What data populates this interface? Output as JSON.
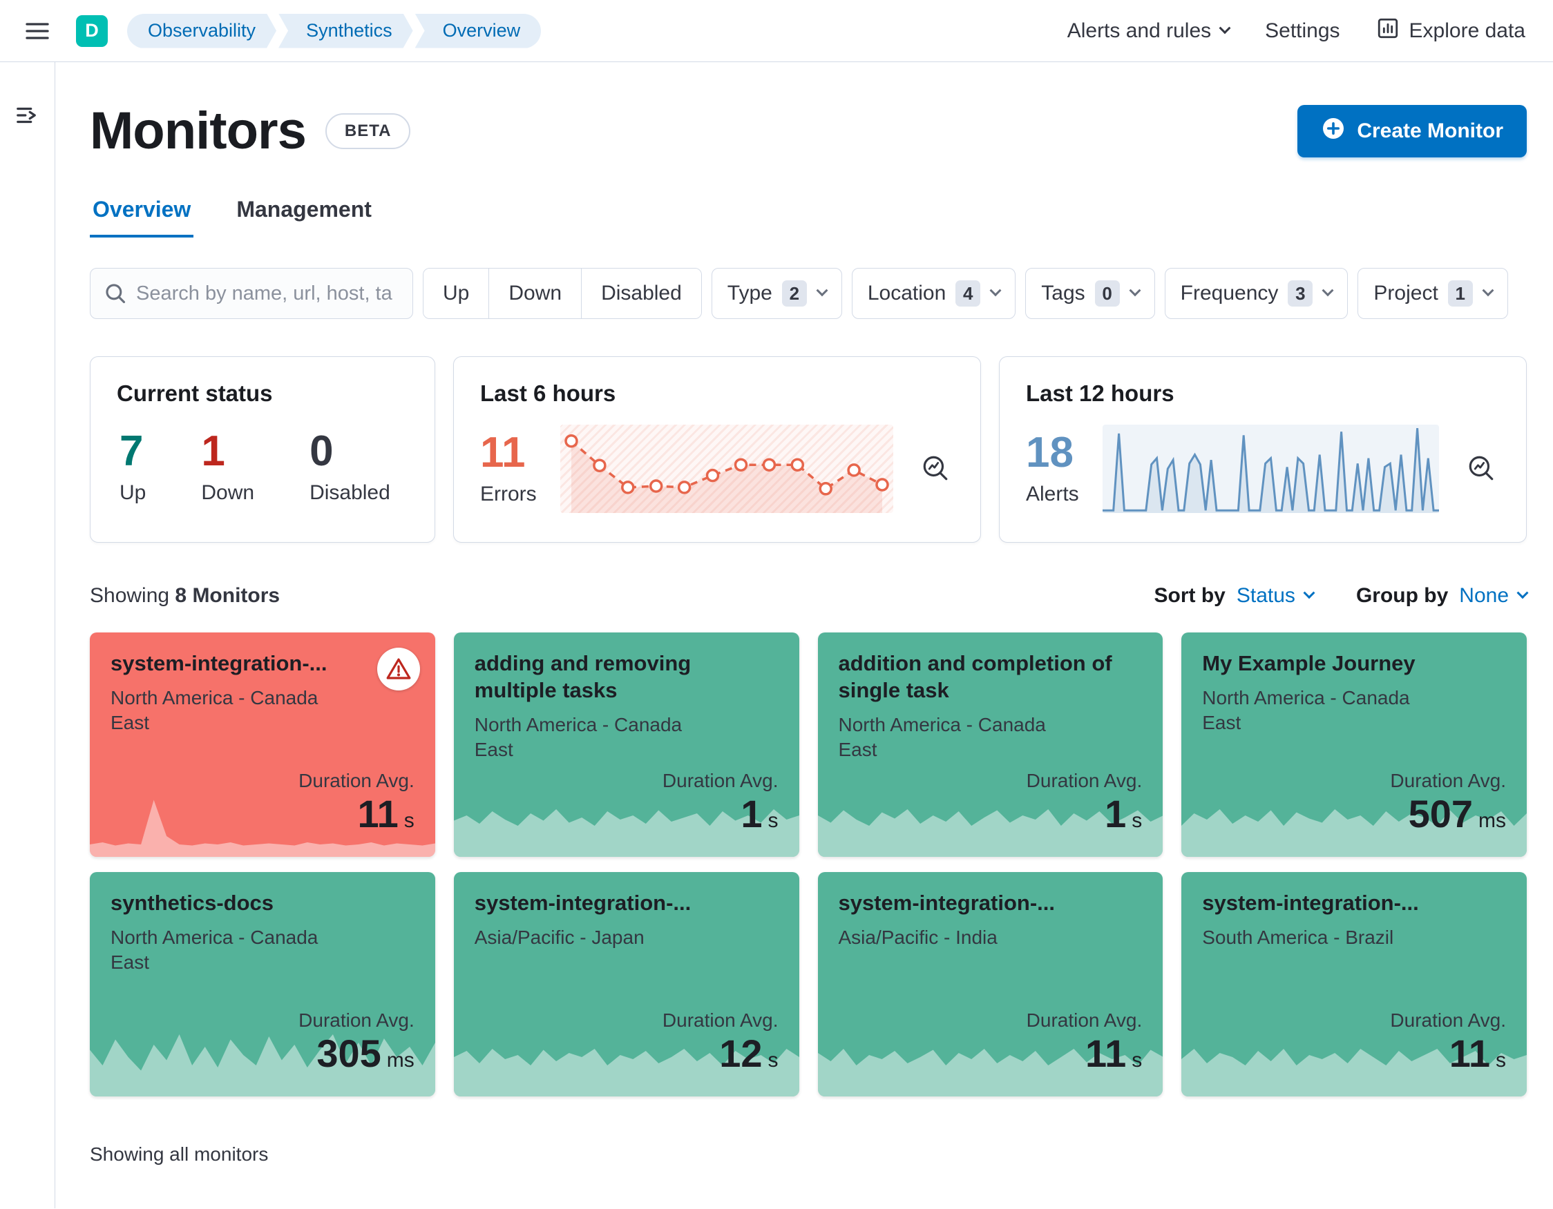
{
  "header": {
    "logo_letter": "D",
    "breadcrumbs": [
      "Observability",
      "Synthetics",
      "Overview"
    ],
    "alerts_menu": "Alerts and rules",
    "settings": "Settings",
    "explore_data": "Explore data"
  },
  "page": {
    "title": "Monitors",
    "beta": "BETA",
    "create_button": "Create Monitor",
    "tabs": [
      {
        "label": "Overview"
      },
      {
        "label": "Management"
      }
    ],
    "search_placeholder": "Search by name, url, host, ta",
    "status_filters": [
      "Up",
      "Down",
      "Disabled"
    ],
    "filters": [
      {
        "label": "Type",
        "count": "2"
      },
      {
        "label": "Location",
        "count": "4"
      },
      {
        "label": "Tags",
        "count": "0"
      },
      {
        "label": "Frequency",
        "count": "3"
      },
      {
        "label": "Project",
        "count": "1"
      }
    ]
  },
  "stats": {
    "current_status": {
      "title": "Current status",
      "up": {
        "value": "7",
        "label": "Up"
      },
      "down": {
        "value": "1",
        "label": "Down"
      },
      "disabled": {
        "value": "0",
        "label": "Disabled"
      }
    },
    "last6": {
      "title": "Last 6 hours",
      "value": "11",
      "label": "Errors",
      "chart": {
        "kind": "dashed",
        "stroke": "#e7664c",
        "fill": "rgba(231,102,76,0.14)",
        "bg": "repeating-linear-gradient(135deg, rgba(231,102,76,0.16) 0px, rgba(231,102,76,0.16) 3px, rgba(231,102,76,0.05) 3px, rgba(231,102,76,0.05) 9px)",
        "values": [
          92,
          55,
          22,
          24,
          22,
          40,
          56,
          56,
          56,
          20,
          48,
          26
        ]
      }
    },
    "last12": {
      "title": "Last 12 hours",
      "value": "18",
      "label": "Alerts",
      "chart": {
        "kind": "area",
        "stroke": "#6092c0",
        "strokeWidth": 3,
        "fill": "rgba(96,146,192,0.14)",
        "bg": "rgba(96,146,192,0.10)",
        "values": [
          3,
          3,
          3,
          90,
          3,
          3,
          3,
          3,
          3,
          55,
          62,
          3,
          50,
          60,
          3,
          3,
          56,
          66,
          55,
          3,
          60,
          3,
          3,
          3,
          3,
          3,
          88,
          3,
          3,
          3,
          56,
          62,
          3,
          3,
          52,
          3,
          62,
          56,
          3,
          3,
          66,
          3,
          3,
          3,
          92,
          3,
          3,
          56,
          3,
          62,
          3,
          3,
          52,
          56,
          3,
          66,
          3,
          3,
          96,
          3,
          62,
          3,
          3
        ]
      }
    }
  },
  "listing": {
    "showing_prefix": "Showing",
    "showing_count": "8 Monitors",
    "sort_label": "Sort by",
    "sort_value": "Status",
    "group_label": "Group by",
    "group_value": "None",
    "duration_label": "Duration Avg.",
    "footer": "Showing all monitors"
  },
  "monitors": [
    {
      "name": "system-integration-...",
      "location": "North America - Canada East",
      "duration": "11",
      "unit": "s",
      "status": "down",
      "spark": [
        12,
        14,
        11,
        13,
        12,
        55,
        20,
        12,
        11,
        13,
        12,
        14,
        11,
        12,
        13,
        12,
        11,
        14,
        12,
        13,
        11,
        12,
        14,
        11,
        13,
        12,
        11,
        13
      ]
    },
    {
      "name": "adding and removing multiple tasks",
      "location": "North America - Canada East",
      "duration": "1",
      "unit": "s",
      "status": "up",
      "spark": [
        35,
        40,
        32,
        44,
        36,
        30,
        42,
        35,
        46,
        33,
        38,
        30,
        44,
        36,
        40,
        32,
        45,
        34,
        38,
        42,
        30,
        44,
        35,
        40,
        33,
        46,
        36,
        40
      ]
    },
    {
      "name": "addition and completion of single task",
      "location": "North America - Canada East",
      "duration": "1",
      "unit": "s",
      "status": "up",
      "spark": [
        40,
        33,
        45,
        36,
        30,
        43,
        37,
        46,
        32,
        40,
        34,
        44,
        30,
        38,
        45,
        33,
        40,
        36,
        46,
        30,
        42,
        35,
        44,
        32,
        38,
        45,
        34,
        40
      ]
    },
    {
      "name": "My Example Journey",
      "location": "North America - Canada East",
      "duration": "507",
      "unit": "ms",
      "status": "up",
      "spark": [
        30,
        42,
        36,
        46,
        32,
        40,
        34,
        45,
        30,
        43,
        37,
        33,
        46,
        36,
        40,
        30,
        44,
        34,
        42,
        38,
        30,
        45,
        33,
        40,
        36,
        44,
        30,
        42
      ]
    },
    {
      "name": "synthetics-docs",
      "location": "North America - Canada East",
      "duration": "305",
      "unit": "ms",
      "status": "up",
      "spark": [
        45,
        30,
        55,
        38,
        25,
        50,
        35,
        60,
        30,
        48,
        28,
        55,
        40,
        30,
        58,
        35,
        50,
        28,
        45,
        60,
        32,
        52,
        30,
        56,
        38,
        48,
        30,
        52
      ]
    },
    {
      "name": "system-integration-...",
      "location": "Asia/Pacific - Japan",
      "duration": "12",
      "unit": "s",
      "status": "up",
      "spark": [
        38,
        44,
        32,
        46,
        36,
        40,
        30,
        45,
        34,
        42,
        38,
        46,
        30,
        40,
        36,
        44,
        32,
        38,
        46,
        34,
        42,
        30,
        44,
        36,
        40,
        32,
        46,
        38
      ]
    },
    {
      "name": "system-integration-...",
      "location": "Asia/Pacific - India",
      "duration": "11",
      "unit": "s",
      "status": "up",
      "spark": [
        42,
        34,
        46,
        30,
        40,
        36,
        44,
        32,
        38,
        45,
        30,
        42,
        36,
        46,
        32,
        40,
        34,
        44,
        30,
        38,
        46,
        33,
        42,
        36,
        40,
        30,
        45,
        38
      ]
    },
    {
      "name": "system-integration-...",
      "location": "South America - Brazil",
      "duration": "11",
      "unit": "s",
      "status": "up",
      "spark": [
        36,
        46,
        32,
        42,
        38,
        30,
        44,
        34,
        46,
        30,
        40,
        36,
        42,
        32,
        46,
        38,
        30,
        44,
        34,
        40,
        46,
        32,
        38,
        44,
        30,
        42,
        36,
        40
      ]
    }
  ],
  "colors": {
    "primary": "#0071c2",
    "brand_teal": "#00bfb3",
    "success_text": "#007871",
    "danger_text": "#bd271e",
    "errors_value": "#e7664c",
    "alerts_value": "#6092c0",
    "card_up": "#54b399",
    "card_down": "#f6726a"
  }
}
